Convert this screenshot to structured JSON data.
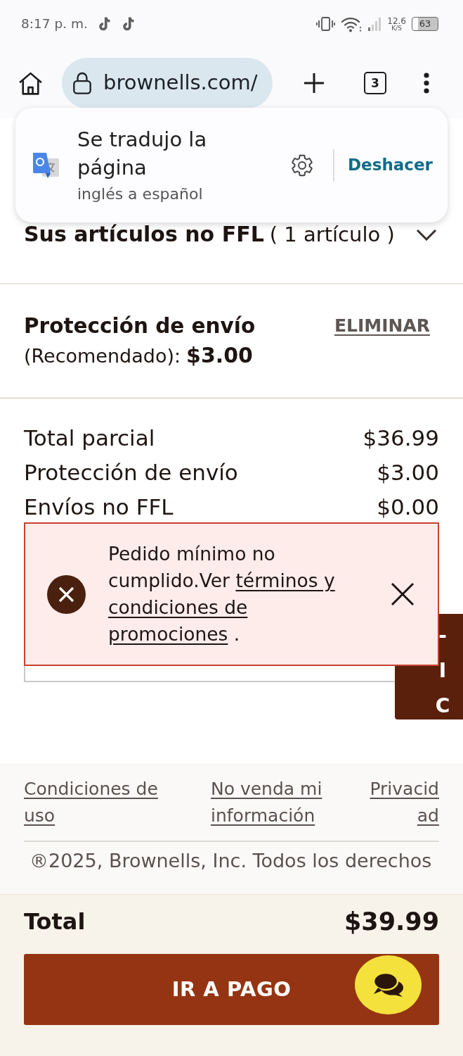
{
  "status_bar": {
    "time": "8:17 p. m.",
    "speed_value": "12.6",
    "speed_unit": "K/S",
    "battery": "63"
  },
  "browser": {
    "url": "brownells.com/",
    "tab_count": "3"
  },
  "translate_popup": {
    "title": "Se tradujo la página",
    "subtitle": "inglés a español",
    "undo": "Deshacer"
  },
  "non_ffl_items": {
    "title": "Sus artículos no FFL",
    "count": "( 1 artículo )",
    "expanded": false
  },
  "shipping_protection": {
    "title": "Protección de envío",
    "note": "(Recomendado):",
    "price": "$3.00",
    "remove": "ELIMINAR"
  },
  "summary": [
    {
      "label": "Total parcial",
      "value": "$36.99"
    },
    {
      "label": "Protección de envío",
      "value": "$3.00"
    },
    {
      "label": "Envíos no FFL",
      "value": "$0.00"
    }
  ],
  "alert": {
    "message": "Pedido mínimo no cumplido.Ver",
    "link_parts": [
      "términos y",
      "condiciones de",
      "promociones"
    ],
    "end": "."
  },
  "side_tab": {
    "letters": [
      "-",
      "I",
      "C"
    ]
  },
  "footer": {
    "links": [
      "Condiciones de uso",
      "No venda mi información",
      "Privacidad"
    ],
    "copyright": "®2025, Brownells, Inc. Todos los derechos"
  },
  "order_total": {
    "label": "Total",
    "value": "$39.99"
  },
  "checkout_button": "IR A PAGO"
}
